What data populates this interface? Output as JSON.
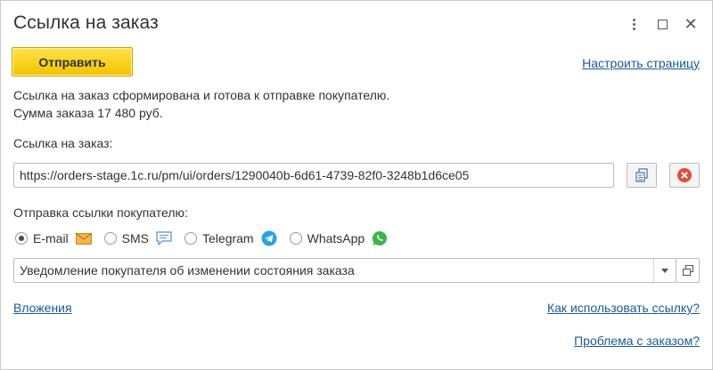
{
  "window": {
    "title": "Ссылка на заказ"
  },
  "toolbar": {
    "send_label": "Отправить",
    "settings_link": "Настроить страницу"
  },
  "info": {
    "line1": "Ссылка на заказ сформирована и готова к отправке покупателю.",
    "line2": "Сумма заказа 17 480 руб."
  },
  "order_link": {
    "label": "Ссылка на заказ:",
    "value": "https://orders-stage.1c.ru/pm/ui/orders/1290040b-6d61-4739-82f0-3248b1d6ce05"
  },
  "send_options": {
    "label": "Отправка ссылки покупателю:",
    "selected": "E-mail",
    "channels": [
      {
        "label": "E-mail",
        "icon": "envelope-icon",
        "color": "#e6a12e"
      },
      {
        "label": "SMS",
        "icon": "chat-bubble-icon",
        "color": "#5a8fc8"
      },
      {
        "label": "Telegram",
        "icon": "telegram-icon",
        "color": "#2aa3de"
      },
      {
        "label": "WhatsApp",
        "icon": "whatsapp-icon",
        "color": "#3ab54a"
      }
    ]
  },
  "template": {
    "value": "Уведомление покупателя об изменении состояния заказа"
  },
  "footer": {
    "attachments_link": "Вложения",
    "how_to_link": "Как использовать ссылку?",
    "problem_link": "Проблема с заказом?"
  },
  "colors": {
    "accent": "#f2c200",
    "link": "#1a5a99",
    "delete": "#e04b3a"
  }
}
